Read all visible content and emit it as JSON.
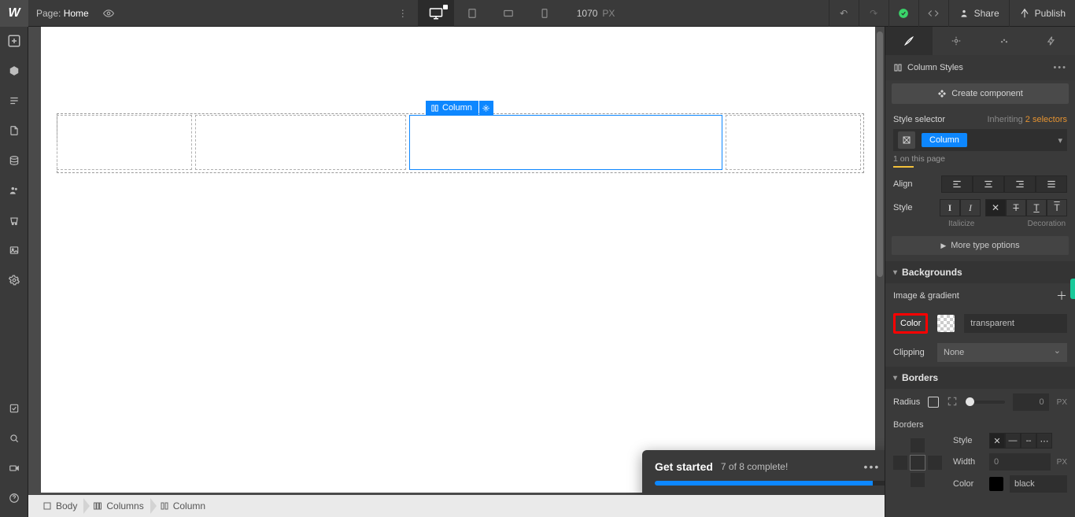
{
  "topbar": {
    "page_prefix": "Page:",
    "page_name": "Home",
    "canvas_width": "1070",
    "canvas_unit": "PX",
    "share": "Share",
    "publish": "Publish"
  },
  "selection_badge": {
    "label": "Column"
  },
  "toast": {
    "title": "Get started",
    "progress_text": "7 of 8 complete!",
    "progress_pct": 87.5
  },
  "breadcrumb": [
    {
      "label": "Body"
    },
    {
      "label": "Columns"
    },
    {
      "label": "Column"
    }
  ],
  "panel": {
    "header_title": "Column Styles",
    "create_component": "Create component",
    "style_selector_label": "Style selector",
    "inheriting_prefix": "Inheriting",
    "inheriting_count": "2 selectors",
    "selector_tag": "Column",
    "on_page": "1 on this page",
    "align_label": "Align",
    "style_label": "Style",
    "italicize": "Italicize",
    "decoration": "Decoration",
    "more_type": "More type options",
    "backgrounds": "Backgrounds",
    "image_gradient": "Image & gradient",
    "color_label": "Color",
    "color_value": "transparent",
    "clipping_label": "Clipping",
    "clipping_value": "None",
    "borders": "Borders",
    "radius_label": "Radius",
    "radius_value": "0",
    "radius_unit": "PX",
    "borders_sub": "Borders",
    "style_sub": "Style",
    "width_sub": "Width",
    "width_value": "0",
    "width_unit": "PX",
    "color_sub": "Color",
    "border_color_value": "black"
  }
}
